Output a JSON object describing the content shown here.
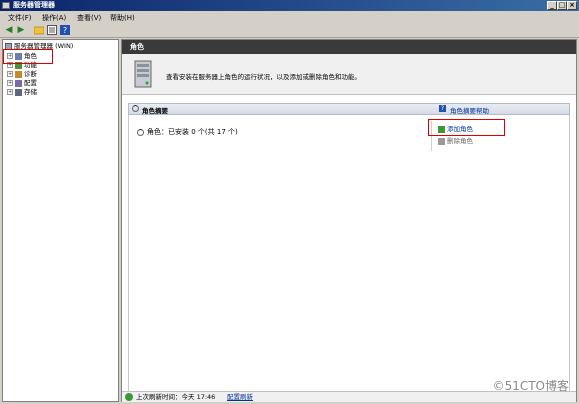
{
  "window": {
    "title": "服务器管理器"
  },
  "window_controls": {
    "minimize": "_",
    "maximize": "□",
    "close": "×"
  },
  "menu": [
    {
      "label": "文件(F)"
    },
    {
      "label": "操作(A)"
    },
    {
      "label": "查看(V)"
    },
    {
      "label": "帮助(H)"
    }
  ],
  "tree": {
    "root": "服务器管理器 (WIN)",
    "items": [
      {
        "label": "角色"
      },
      {
        "label": "功能"
      },
      {
        "label": "诊断"
      },
      {
        "label": "配置"
      },
      {
        "label": "存储"
      }
    ]
  },
  "main": {
    "header": "角色",
    "intro_text": "查看安装在服务器上角色的运行状况，以及添加或删除角色和功能。",
    "summary_title": "角色摘要",
    "summary_help": "角色摘要帮助",
    "roles_status": "角色：已安装 0 个(共 17 个)",
    "actions": {
      "add": "添加角色",
      "remove": "删除角色"
    },
    "status": {
      "prefix": "上次刷新时间：今天 17:46",
      "link": "配置刷新"
    }
  },
  "watermark": "©51CTO博客"
}
